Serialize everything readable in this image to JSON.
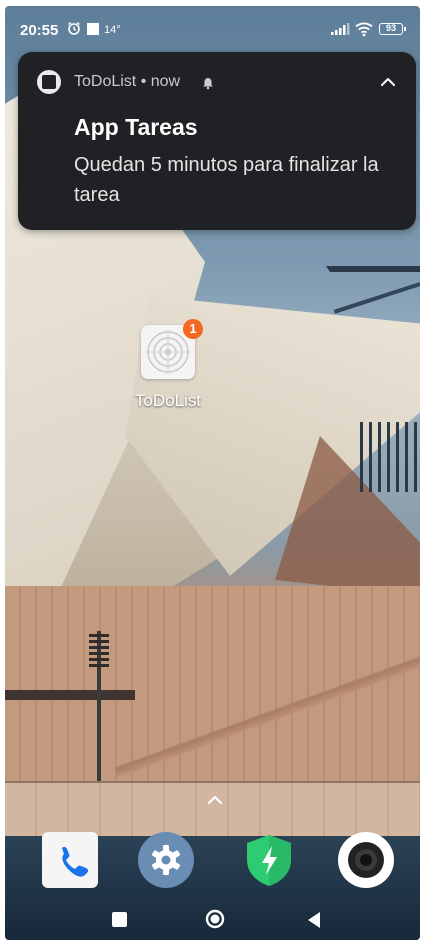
{
  "status_bar": {
    "time": "20:55",
    "temperature": "14°",
    "battery_level": "93",
    "icons": [
      "alarm-icon",
      "notification-square-icon",
      "signal-icon",
      "wifi-icon",
      "battery-icon"
    ]
  },
  "notification": {
    "app_name": "ToDoList",
    "time_label": "now",
    "header_separator": " • ",
    "title": "App Tareas",
    "body": "Quedan 5 minutos para finalizar la tarea",
    "icons": [
      "app-icon",
      "alarm-bell-icon",
      "expand-chevron-icon"
    ]
  },
  "home": {
    "app_label": "ToDoList",
    "badge_count": "1",
    "badge_color": "#f26a22"
  },
  "dock": {
    "apps": [
      "phone-app",
      "settings-app",
      "security-app",
      "camera-app"
    ]
  },
  "nav_bar": {
    "buttons": [
      "recent-apps",
      "home",
      "back"
    ]
  }
}
